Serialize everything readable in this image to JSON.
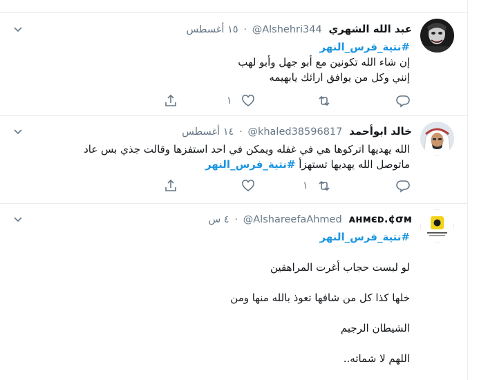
{
  "tweets": [
    {
      "name": "عبد الله الشهري",
      "handle": "@Alshehri344",
      "time": "١٥ أغسطس",
      "hashtag": "#نتية_فرس_النهر",
      "lines": [
        "إن شاء الله تكونين مع أبو جهل وأبو لهب",
        "إنني وكل من يوافق ارائك يابهيمه"
      ],
      "like_count": "١",
      "retweet_count": ""
    },
    {
      "name": "خالد ابوأحمد",
      "handle": "@khaled38596817",
      "time": "١٤ أغسطس",
      "line1": "الله يهديها اتركوها هي في غفله ويمكن في احد استفزها وقالت جذي بس عاد",
      "line2": "ماتوصل الله يهديها تستهزأ",
      "hashtag": "#نتية_فرس_النهر",
      "like_count": "",
      "retweet_count": "١"
    },
    {
      "name": "ᴀнмєᴅ.¢σм",
      "handle": "@AlshareefaAhmed",
      "time": "٤ س",
      "hashtag": "#نتية_فرس_النهر",
      "paragraphs": [
        "لو لبست حجاب أغرت المراهقين",
        "خلها كذا كل من شافها تعوذ بالله منها ومن",
        "الشيطان الرجيم",
        "اللهم لا شماته.."
      ]
    }
  ],
  "colors": {
    "accent": "#1b95e0",
    "muted": "#657786",
    "border": "#e6ecf0"
  },
  "icons": [
    "caret-down-icon",
    "reply-icon",
    "retweet-icon",
    "like-icon",
    "share-icon"
  ]
}
